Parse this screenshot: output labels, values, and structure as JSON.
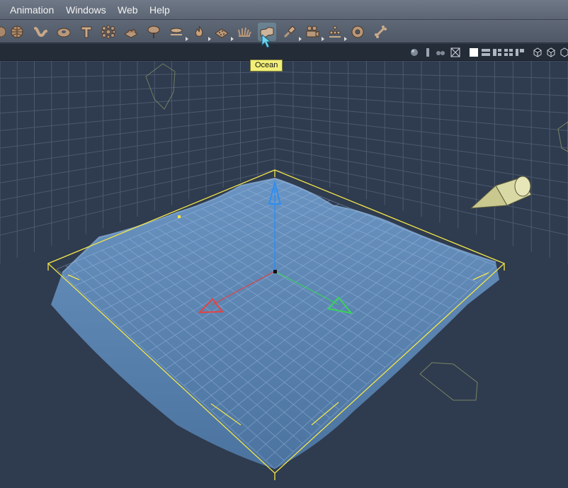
{
  "menu": [
    "Animation",
    "Windows",
    "Web",
    "Help"
  ],
  "toolbar": {
    "tools": [
      {
        "icon": "tool-partial-icon"
      },
      {
        "icon": "planet-icon"
      },
      {
        "icon": "path-icon"
      },
      {
        "icon": "torus-icon"
      },
      {
        "icon": "text-icon"
      },
      {
        "icon": "metablob-icon"
      },
      {
        "icon": "terrain-icon"
      },
      {
        "icon": "plant-icon"
      },
      {
        "icon": "cloud-layer-icon"
      },
      {
        "icon": "fire-icon"
      },
      {
        "icon": "rock-icon"
      },
      {
        "icon": "grass-icon"
      },
      {
        "icon": "ocean-icon"
      },
      {
        "icon": "light-icon"
      },
      {
        "icon": "camera-icon"
      },
      {
        "icon": "ecosystem-icon"
      },
      {
        "icon": "target-icon"
      },
      {
        "icon": "bone-icon"
      }
    ],
    "hovered_tool": "Ocean"
  },
  "tooltip": {
    "text": "Ocean"
  },
  "viewbar": {
    "icons": [
      "sphere-view-icon",
      "column-icon",
      "group-icon",
      "wireframe-icon",
      "layout-single-icon",
      "layout-rows-icon",
      "layout-split-icon",
      "layout-quad-icon",
      "layout-custom-icon",
      "camera-view-1-icon",
      "camera-view-2-icon",
      "camera-view-3-icon"
    ]
  },
  "colors": {
    "viewport_bg": "#2f3b4e",
    "bounding_box": "#f2e64a",
    "ocean": "#5a86b8",
    "axis_x": "#e04444",
    "axis_y": "#2e8ef0",
    "axis_z": "#39d35a",
    "tooltip_bg": "#f2ef7a",
    "light_object": "#d9d9a6"
  }
}
